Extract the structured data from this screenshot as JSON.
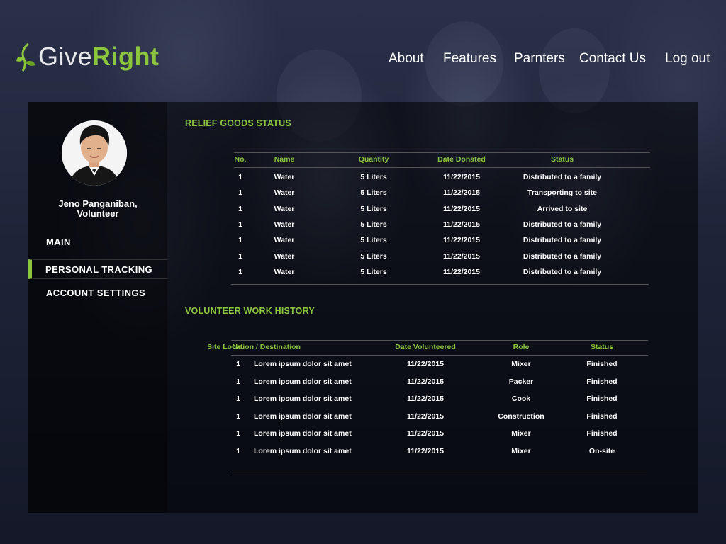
{
  "brand": {
    "give": "Give",
    "right": "Right",
    "accent": "#8cc63f"
  },
  "nav": {
    "items": [
      "About",
      "Features",
      "Parnters",
      "Contact Us",
      "Log out"
    ]
  },
  "user": {
    "name_line1": "Jeno Panganiban,",
    "name_line2": "Volunteer"
  },
  "sidebar": {
    "items": [
      {
        "label": "MAIN"
      },
      {
        "label": "PERSONAL TRACKING",
        "active": true
      },
      {
        "label": "ACCOUNT SETTINGS"
      }
    ]
  },
  "relief": {
    "title": "RELIEF GOODS STATUS",
    "headers": [
      "No.",
      "Name",
      "Quantity",
      "Date Donated",
      "Status"
    ],
    "rows": [
      [
        "1",
        "Water",
        "5 Liters",
        "11/22/2015",
        "Distributed to a family"
      ],
      [
        "1",
        "Water",
        "5 Liters",
        "11/22/2015",
        "Transporting to site"
      ],
      [
        "1",
        "Water",
        "5 Liters",
        "11/22/2015",
        "Arrived to site"
      ],
      [
        "1",
        "Water",
        "5 Liters",
        "11/22/2015",
        "Distributed to a family"
      ],
      [
        "1",
        "Water",
        "5 Liters",
        "11/22/2015",
        "Distributed to a family"
      ],
      [
        "1",
        "Water",
        "5 Liters",
        "11/22/2015",
        "Distributed to a family"
      ],
      [
        "1",
        "Water",
        "5 Liters",
        "11/22/2015",
        "Distributed to a family"
      ]
    ]
  },
  "volunteer": {
    "title": "VOLUNTEER WORK HISTORY",
    "headers": [
      "No.",
      "Site Location / Destination",
      "Date Volunteered",
      "Role",
      "Status"
    ],
    "rows": [
      [
        "1",
        "Lorem ipsum dolor sit amet",
        "11/22/2015",
        "Mixer",
        "Finished"
      ],
      [
        "1",
        "Lorem ipsum dolor sit amet",
        "11/22/2015",
        "Packer",
        "Finished"
      ],
      [
        "1",
        "Lorem ipsum dolor sit amet",
        "11/22/2015",
        "Cook",
        "Finished"
      ],
      [
        "1",
        "Lorem ipsum dolor sit amet",
        "11/22/2015",
        "Construction",
        "Finished"
      ],
      [
        "1",
        "Lorem ipsum dolor sit amet",
        "11/22/2015",
        "Mixer",
        "Finished"
      ],
      [
        "1",
        "Lorem ipsum dolor sit amet",
        "11/22/2015",
        "Mixer",
        "On-site"
      ]
    ]
  }
}
